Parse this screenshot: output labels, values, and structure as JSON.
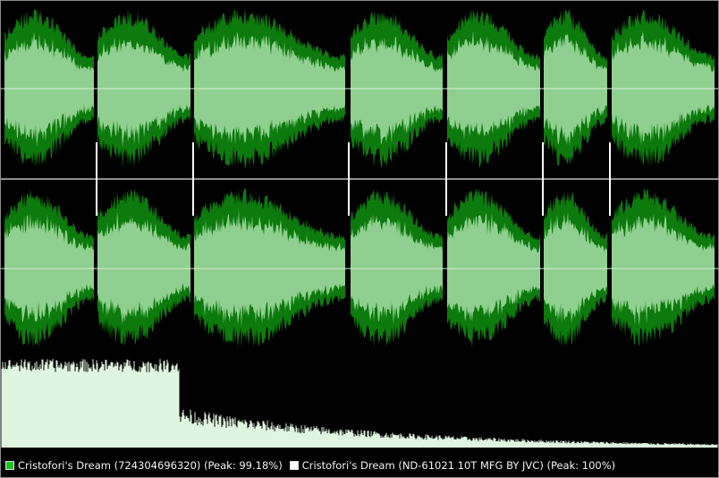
{
  "legend": {
    "items": [
      {
        "label": "Cristofori's Dream (724304696320) (Peak: 99.18%)",
        "color": "#22c222"
      },
      {
        "label": "Cristofori's Dream (ND-61021 10T MFG BY JVC) (Peak: 100%)",
        "color": "#ffffff"
      }
    ]
  },
  "colors": {
    "background": "#000000",
    "wave_outer": "#0c7a0c",
    "wave_inner": "#8fcf8f",
    "divider": "#c0c0c0",
    "center_line": "#d8ecd8",
    "spectrum": "#dff5df"
  }
}
